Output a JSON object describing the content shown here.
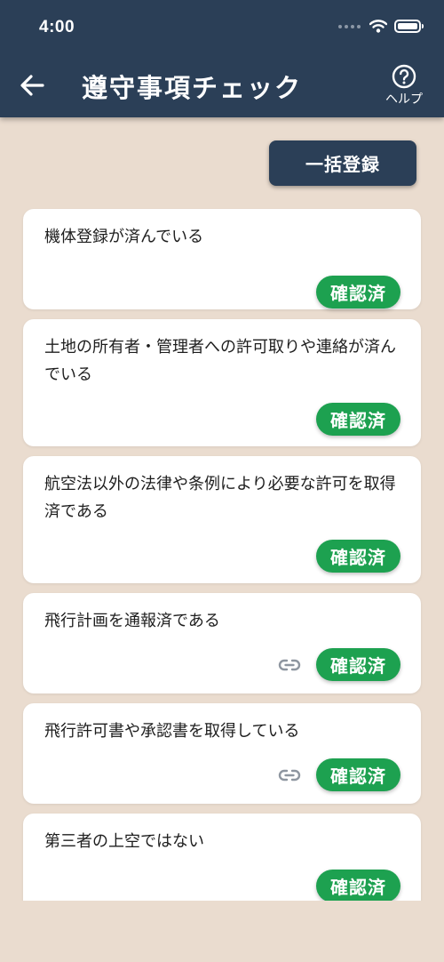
{
  "status_bar": {
    "time": "4:00"
  },
  "header": {
    "title": "遵守事項チェック",
    "help_label": "ヘルプ"
  },
  "bulk_register_label": "一括登録",
  "items": [
    {
      "text": "機体登録が済んでいる",
      "status": "確認済",
      "has_link": false
    },
    {
      "text": "土地の所有者・管理者への許可取りや連絡が済んでいる",
      "status": "確認済",
      "has_link": false
    },
    {
      "text": "航空法以外の法律や条例により必要な許可を取得済である",
      "status": "確認済",
      "has_link": false
    },
    {
      "text": "飛行計画を通報済である",
      "status": "確認済",
      "has_link": true
    },
    {
      "text": "飛行許可書や承認書を取得している",
      "status": "確認済",
      "has_link": true
    },
    {
      "text": "第三者の上空ではない",
      "status": "確認済",
      "has_link": false
    }
  ],
  "icons": {
    "back": "arrow-left-icon",
    "help": "question-circle-icon",
    "link": "link-icon",
    "wifi": "wifi-icon",
    "battery": "battery-icon"
  },
  "colors": {
    "header_bg": "#2B3F57",
    "page_bg": "#EADCCF",
    "badge_green": "#1DA150",
    "link_gray": "#8E96A0"
  }
}
